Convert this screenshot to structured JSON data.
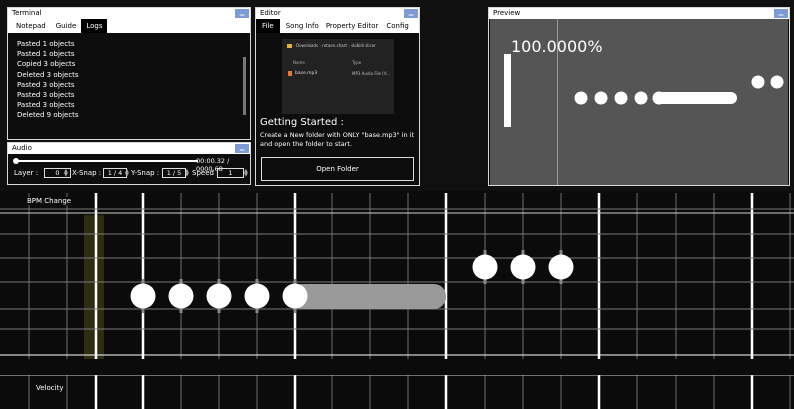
{
  "terminal": {
    "title": "Terminal",
    "tabs": [
      "Notepad",
      "Guide",
      "Logs"
    ],
    "active_tab": "Logs",
    "logs": [
      "Pasted 1 objects",
      "Pasted 1 objects",
      "Copied 3 objects",
      "Deleted 3 objects",
      "Pasted 3 objects",
      "Pasted 3 objects",
      "Pasted 3 objects",
      "Deleted 9 objects"
    ]
  },
  "audio": {
    "title": "Audio",
    "time": "00:00.32 / 0000.68",
    "progress": 0.02,
    "layer_label": "Layer :",
    "layer_value": "0",
    "xsnap_label": "X-Snap :",
    "xsnap_value": "1 / 4",
    "ysnap_label": "Y-Snap :",
    "ysnap_value": "1 / 5",
    "speed_label": "Speed :",
    "speed_value": "1"
  },
  "editor": {
    "title": "Editor",
    "tabs": [
      "File",
      "Song Info",
      "Property Editor",
      "Config"
    ],
    "active_tab": "File",
    "breadcrumb": [
      "Downloads",
      "rotaen.chart",
      "skibidi slicer"
    ],
    "file_col_name": "Name",
    "file_col_type": "Type",
    "file_name": "base.mp3",
    "file_type": "MP3 Audio File (V...",
    "heading": "Getting Started :",
    "body": "Create a New folder with ONLY \"base.mp3\" in it and open the folder to start.",
    "open_button": "Open Folder"
  },
  "preview": {
    "title": "Preview",
    "percent": "100.0000%"
  },
  "timeline": {
    "bpm_label": "BPM Change",
    "velocity_label": "Velocity"
  },
  "colors": {
    "accent": "#7d9bd4",
    "panel_bg": "#0d0d0d",
    "preview_bg": "#555555"
  }
}
